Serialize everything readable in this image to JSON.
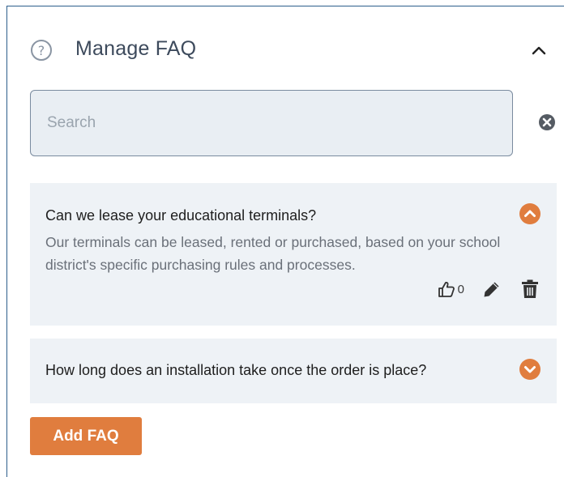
{
  "header": {
    "title": "Manage FAQ",
    "help_icon": "question-circle-icon",
    "collapse_icon": "chevron-up-icon"
  },
  "search": {
    "placeholder": "Search",
    "value": "",
    "clear_icon": "times-circle-icon"
  },
  "faqs": [
    {
      "question": "Can we lease your educational terminals?",
      "answer": "Our terminals can be leased, rented or purchased, based on your school district's specific purchasing rules and processes.",
      "expanded": true,
      "likes": "0",
      "toggle_icon": "chevron-up-circle-icon",
      "actions": [
        "thumbs-up-icon",
        "pencil-icon",
        "trash-icon"
      ]
    },
    {
      "question": "How long does an installation take once the order is place?",
      "expanded": false,
      "toggle_icon": "chevron-down-circle-icon"
    }
  ],
  "add_button": {
    "label": "Add FAQ"
  },
  "colors": {
    "accent": "#e07d3e",
    "panel_border": "#2d5e8c",
    "item_bg": "#eef2f6",
    "search_bg": "#e9eef3"
  }
}
